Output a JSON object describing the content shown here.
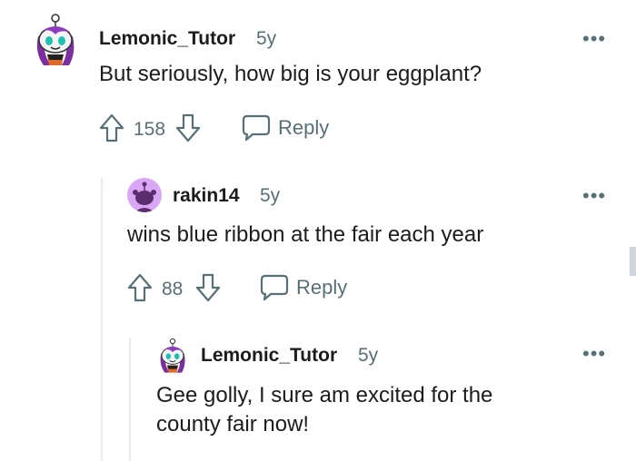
{
  "comments": [
    {
      "username": "Lemonic_Tutor",
      "age": "5y",
      "body": "But seriously, how big is your eggplant?",
      "votes": "158",
      "reply_label": "Reply",
      "more_label": "•••"
    },
    {
      "username": "rakin14",
      "age": "5y",
      "body": "wins blue ribbon at the fair each year",
      "votes": "88",
      "reply_label": "Reply",
      "more_label": "•••"
    },
    {
      "username": "Lemonic_Tutor",
      "age": "5y",
      "body_line1": "Gee golly, I sure am excited for the",
      "body_line2": "county fair now!",
      "more_label": "•••"
    }
  ],
  "colors": {
    "text": "#1c1c1c",
    "meta": "#576f76",
    "thread_line": "#e5ebee",
    "avatar_purple": "#d9a7f5"
  },
  "icons": [
    "upvote-icon",
    "downvote-icon",
    "reply-icon",
    "more-options-icon"
  ]
}
